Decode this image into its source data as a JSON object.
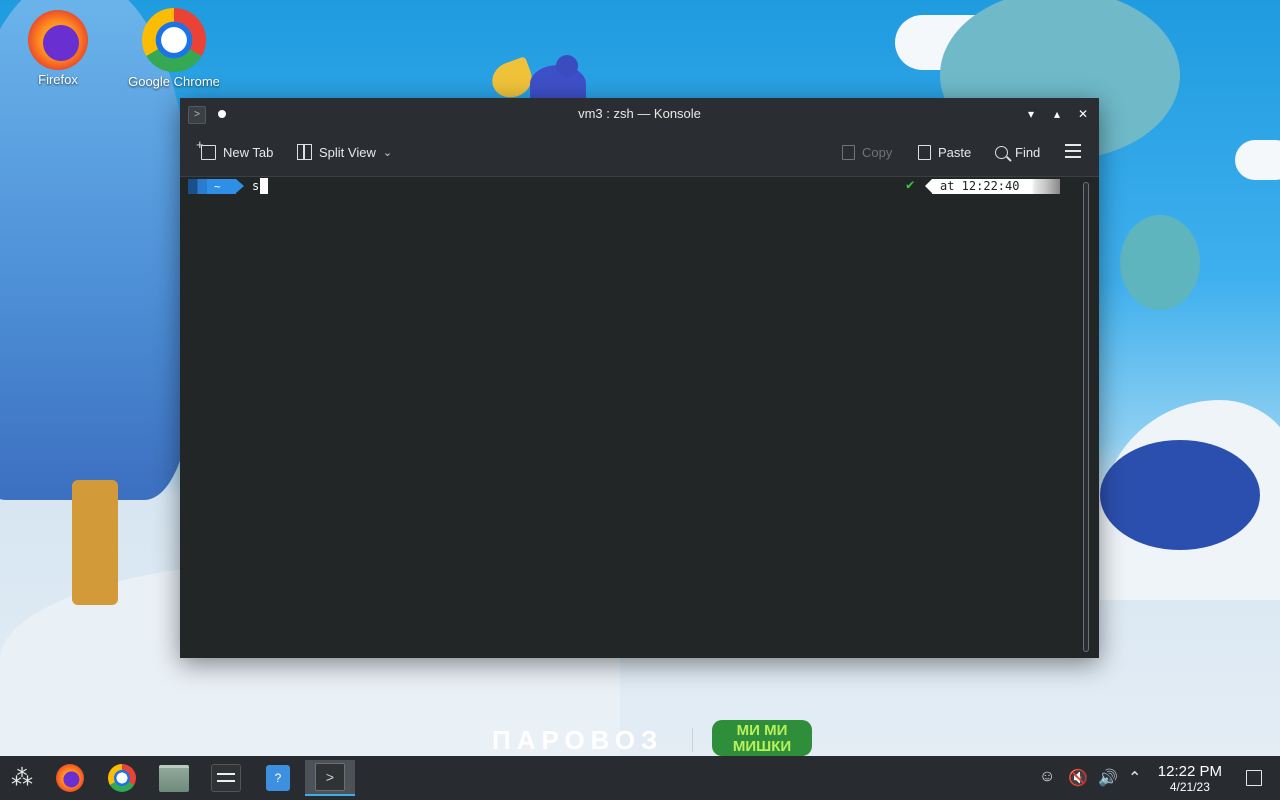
{
  "desktop": {
    "icons": [
      {
        "label": "Firefox"
      },
      {
        "label": "Google Chrome"
      }
    ],
    "wallpaper_logo_left": "ПАРОВОЗ",
    "wallpaper_logo_right": "МИ МИ МИШКИ"
  },
  "window": {
    "title": "vm3 : zsh — Konsole",
    "app_icon_glyph": ">",
    "controls": {
      "minimize": "▾",
      "maximize": "▴",
      "close": "✕"
    }
  },
  "toolbar": {
    "new_tab": "New Tab",
    "split_view": "Split View",
    "copy": "Copy",
    "paste": "Paste",
    "find": "Find"
  },
  "terminal": {
    "prompt_dir": "~",
    "command": "s",
    "status_check": "✔",
    "status_time": "at 12:22:40"
  },
  "taskbar": {
    "launcher_glyph": "⁂",
    "konsole_glyph": ">",
    "store_glyph": "?",
    "clock_time": "12:22 PM",
    "clock_date": "4/21/23"
  },
  "colors": {
    "accent": "#3daee9",
    "terminal_bg": "#232627",
    "titlebar_bg": "#2a2e32",
    "taskbar_bg": "#282c30"
  }
}
